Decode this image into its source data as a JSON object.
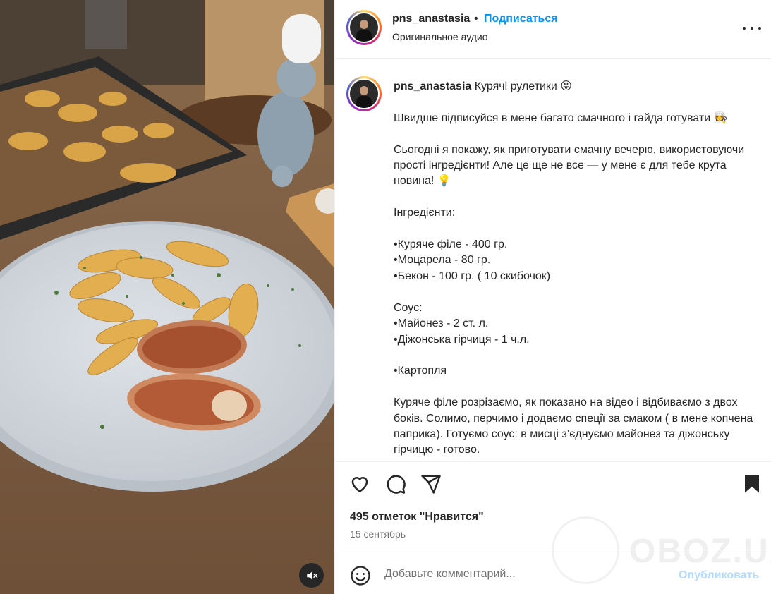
{
  "post": {
    "username": "pns_anastasia",
    "follow_label": "Подписаться",
    "separator": "•",
    "audio_label": "Оригинальное аудио"
  },
  "caption": {
    "username": "pns_anastasia",
    "text": " Курячі рулетики 😝\n\nШвидше підписуйся в мене багато смачного і гайда готувати 👩‍🍳\n\nСьогодні я покажу, як приготувати смачну вечерю, використовуючи прості інгредієнти! Але це ще не все — у мене є для тебе крута новина! 💡\n\nІнгредієнти:\n\n•Куряче філе - 400 гр.\n•Моцарела - 80 гр.\n•Бекон - 100 гр. ( 10 скибочок)\n\nСоус:\n•Майонез - 2 ст. л.\n•Діжонська гірчиця - 1 ч.л.\n\n•Картопля\n\nКуряче філе розрізаємо, як показано на відео і відбиваємо з двох боків. Солимо, перчимо і додаємо спеції за смаком ( в мене копчена паприка). Готуємо соус: в мисці з’єднуємо майонез та діжонську гірчицю - готово."
  },
  "stats": {
    "likes": "495 отметок \"Нравится\"",
    "date": "15 сентябрь"
  },
  "comment": {
    "placeholder": "Добавьте комментарий...",
    "post_label": "Опубликовать"
  },
  "watermark": {
    "text": "OBOZ.UA"
  },
  "icons": {
    "like": "heart-icon",
    "comment": "comment-icon",
    "share": "send-icon",
    "save": "bookmark-icon",
    "more": "more-icon",
    "mute": "muted-speaker-icon",
    "emoji": "emoji-icon"
  },
  "colors": {
    "accent": "#0095f6",
    "post_disabled": "#b3dbff",
    "text": "#262626",
    "secondary": "#737373"
  }
}
